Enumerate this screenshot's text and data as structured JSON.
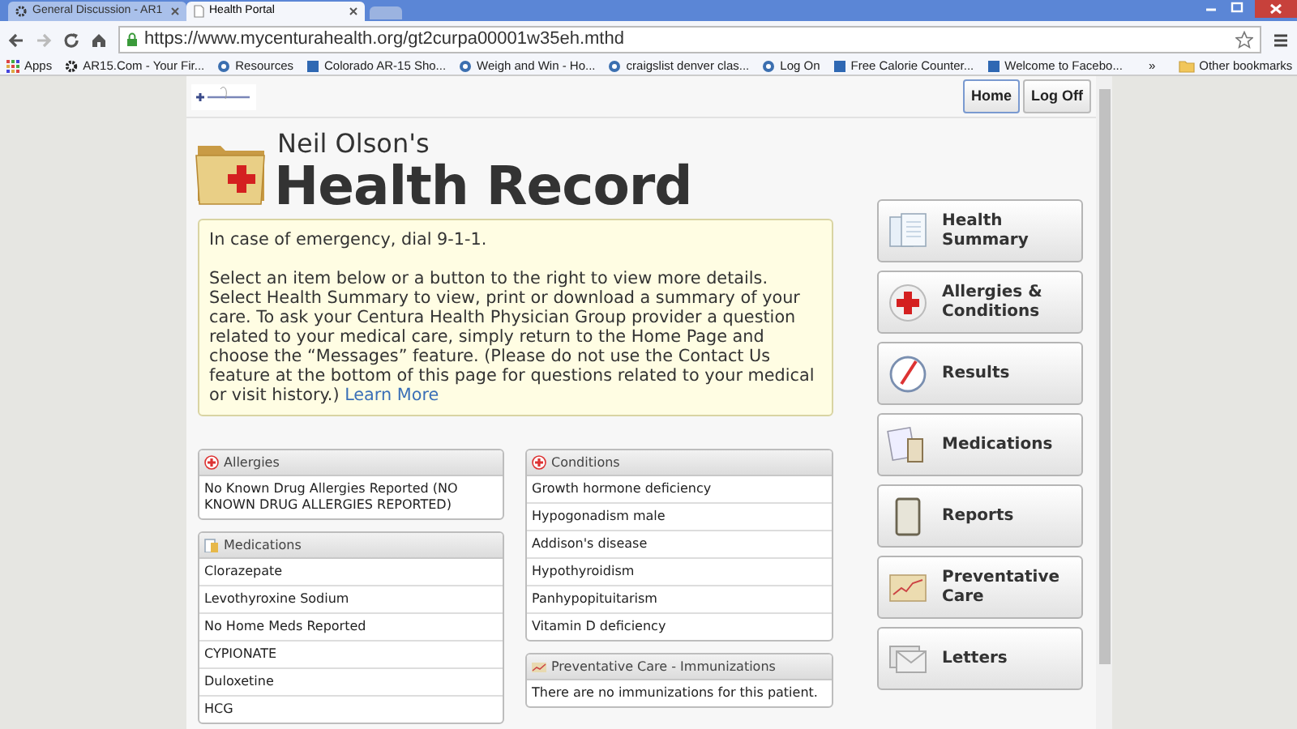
{
  "browser": {
    "tabs": [
      {
        "title": "General Discussion - AR1",
        "selected": false
      },
      {
        "title": "Health Portal",
        "selected": true
      }
    ],
    "url": "https://www.mycenturahealth.org/gt2curpa00001w35eh.mthd",
    "bookmarks": [
      {
        "label": "Apps",
        "kind": "apps"
      },
      {
        "label": "AR15.Com - Your Fir...",
        "kind": "gear"
      },
      {
        "label": "Resources",
        "kind": "circle"
      },
      {
        "label": "Colorado AR-15 Sho...",
        "kind": "square"
      },
      {
        "label": "Weigh and Win - Ho...",
        "kind": "circle"
      },
      {
        "label": "craigslist denver clas...",
        "kind": "circle"
      },
      {
        "label": "Log On",
        "kind": "circle"
      },
      {
        "label": "Free Calorie Counter...",
        "kind": "square"
      },
      {
        "label": "Welcome to Facebo...",
        "kind": "square"
      }
    ],
    "more": "»",
    "other_bookmarks": "Other bookmarks"
  },
  "header": {
    "buttons": [
      {
        "label": "Home",
        "selected": true
      },
      {
        "label": "Log Off",
        "selected": false
      }
    ],
    "owner": "Neil Olson's",
    "title": "Health Record"
  },
  "notice": {
    "line_1": "In case of emergency, dial 9-1-1.",
    "body": "Select an item below or a button to the right to view more details. Select Health Summary to view, print or download a summary of your care. To ask your Centura Health Physician Group provider a question related to your medical care, simply return to the Home Page and choose the “Messages” feature. (Please do not use the Contact Us feature at the bottom of this page for questions related to your medical or visit history.)",
    "link": "Learn More"
  },
  "panels_left": [
    {
      "title": "Allergies",
      "kind": "cross",
      "rows": [
        "No Known Drug Allergies Reported (NO KNOWN DRUG ALLERGIES REPORTED)"
      ]
    },
    {
      "title": "Medications",
      "kind": "meds",
      "rows": [
        "Clorazepate",
        "Levothyroxine Sodium",
        "No Home Meds Reported",
        "CYPIONATE",
        "Duloxetine",
        "HCG"
      ]
    }
  ],
  "panels_right": [
    {
      "title": "Conditions",
      "kind": "cross",
      "rows": [
        "Growth hormone deficiency",
        "Hypogonadism male",
        "Addison's disease",
        "Hypothyroidism",
        "Panhypopituitarism",
        "Vitamin D deficiency"
      ]
    },
    {
      "title": "Preventative Care - Immunizations",
      "kind": "chart",
      "rows": [
        "There are no immunizations for this patient."
      ]
    }
  ],
  "nav": [
    {
      "label": "Health Summary",
      "kind": "docs"
    },
    {
      "label": "Allergies & Conditions",
      "kind": "cross"
    },
    {
      "label": "Results",
      "kind": "gauge"
    },
    {
      "label": "Medications",
      "kind": "meds"
    },
    {
      "label": "Reports",
      "kind": "clipboard"
    },
    {
      "label": "Preventative Care",
      "kind": "chart"
    },
    {
      "label": "Letters",
      "kind": "letters"
    }
  ]
}
